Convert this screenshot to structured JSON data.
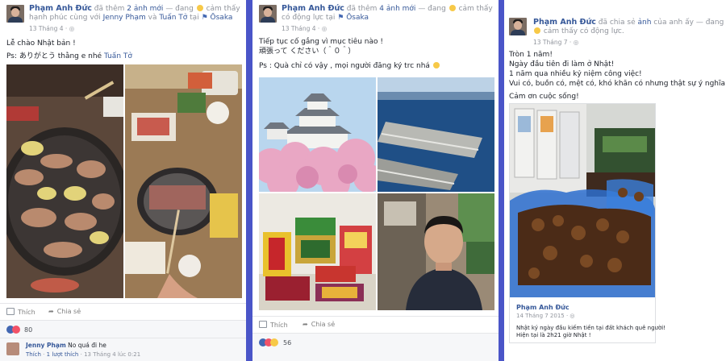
{
  "posts": [
    {
      "author": "Phạm Anh Đức",
      "action": "đã thêm",
      "count_link": "2 ảnh mới",
      "feeling_prefix": "— đang",
      "feeling": "cảm thấy hạnh phúc cùng với",
      "tag1": "Jenny Phạm",
      "conj": "và",
      "tag2": "Tuấn Tở",
      "at": "tại",
      "place": "Ōsaka",
      "date": "13 Tháng 4 ·",
      "lines": [
        "Lễ chào Nhật bản !"
      ],
      "line2_prefix": "Ps: ありがとう thằng e nhé",
      "line2_tag": "Tuấn Tở",
      "like_label": "Thích",
      "share_label": "Chia sẻ",
      "reaction_count": "80",
      "comment": {
        "author": "Jenny Phạm",
        "text": "No quá đi he",
        "like_label": "Thích",
        "sep": " · ",
        "likes": "1 lượt thích",
        "time": "13 Tháng 4 lúc 0:21"
      }
    },
    {
      "author": "Phạm Anh Đức",
      "action": "đã thêm",
      "count_link": "4 ảnh mới",
      "feeling_prefix": "— đang",
      "feeling": "cảm thấy có động lực",
      "at": "tại",
      "place": "Ōsaka",
      "date": "13 Tháng 4 ·",
      "lines": [
        "Tiếp tục cố gắng vì mục tiêu nào !",
        "頑張って ください（＾０＾）",
        "",
        "Ps : Quà chỉ có vậy , mọi người đăng ký trc nhá"
      ],
      "like_label": "Thích",
      "share_label": "Chia sẻ",
      "reaction_count": "56"
    },
    {
      "author": "Phạm Anh Đức",
      "action": "đã chia sẻ",
      "count_link": "ảnh",
      "suffix": "của anh ấy",
      "feeling_prefix": "— đang",
      "feeling": "cảm thấy có động lực.",
      "date": "13 Tháng 7 ·",
      "lines": [
        "Tròn 1 năm!",
        "Ngày đầu tiên đi làm ở Nhật!",
        "1 năm qua nhiều kỷ niệm công việc!",
        "Vui có, buồn có, mệt có, khó khăn có nhưng thật sự ý nghĩa!",
        "",
        "Cảm ơn cuộc sống!"
      ],
      "shared": {
        "author": "Phạm Anh Đức",
        "date": "14 Tháng 7 2015 ·",
        "lines": [
          "Nhật ký ngày đầu kiếm tiền tại đất khách quê người!",
          "Hiện tại là 2h21 giờ Nhật !"
        ]
      }
    }
  ],
  "colors": {
    "link": "#365899",
    "meta": "#90949c",
    "divider": "#4a55c8",
    "like_blue": "#4267b2",
    "love_red": "#f25268",
    "haha_yellow": "#f7c948"
  }
}
